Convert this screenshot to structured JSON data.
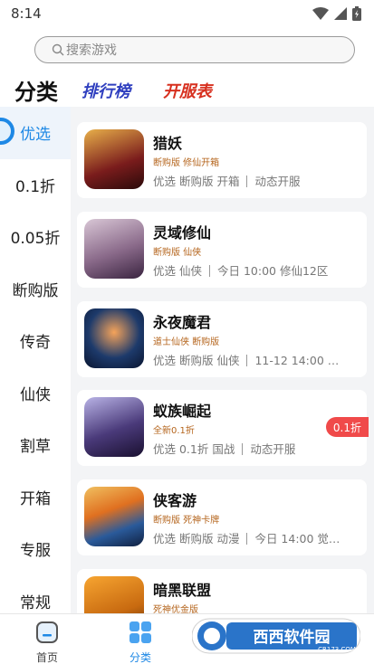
{
  "status_bar": {
    "time": "8:14"
  },
  "search": {
    "placeholder": "搜索游戏"
  },
  "top_tabs": {
    "category": "分类",
    "ranking": "排行榜",
    "server": "开服表"
  },
  "sidebar": {
    "items": [
      {
        "label": "优选",
        "active": true
      },
      {
        "label": "0.1折"
      },
      {
        "label": "0.05折"
      },
      {
        "label": "断购版"
      },
      {
        "label": "传奇"
      },
      {
        "label": "仙侠"
      },
      {
        "label": "割草"
      },
      {
        "label": "开箱"
      },
      {
        "label": "专服"
      },
      {
        "label": "常规"
      }
    ]
  },
  "games": [
    {
      "name": "猎妖",
      "sub": "断购版 修仙开箱",
      "tags": "优选  断购版  开箱",
      "status": "动态开服",
      "thumb_color": "#7a1c1c"
    },
    {
      "name": "灵域修仙",
      "sub": "断购版 仙侠",
      "tags": "优选  仙侠",
      "status": "今日 10:00 修仙12区",
      "thumb_color": "#8a6a8a"
    },
    {
      "name": "永夜魔君",
      "sub": "道士仙侠 断购版",
      "tags": "优选  断购版  仙侠",
      "status": "11-12 14:00 …",
      "thumb_color": "#1d3a6b"
    },
    {
      "name": "蚁族崛起",
      "sub": "全新0.1折",
      "tags": "优选  0.1折  国战",
      "status": "动态开服",
      "badge": "0.1折",
      "thumb_color": "#4a3a7a"
    },
    {
      "name": "侠客游",
      "sub": "断购版 死神卡牌",
      "tags": "优选  断购版  动漫",
      "status": "今日 14:00 觉…",
      "thumb_color": "#2a5a9a"
    },
    {
      "name": "暗黑联盟",
      "sub": "死神优金版",
      "tags": "",
      "status": "",
      "thumb_color": "#c86a10"
    }
  ],
  "bottom_nav": {
    "home": "首页",
    "category": "分类"
  },
  "watermark": {
    "text": "西西软件园",
    "domain": "CR173.COM"
  },
  "colors": {
    "accent": "#1e88e5",
    "ranking": "#2f3fbf",
    "server": "#d7301f",
    "badge": "#f04a4a"
  }
}
